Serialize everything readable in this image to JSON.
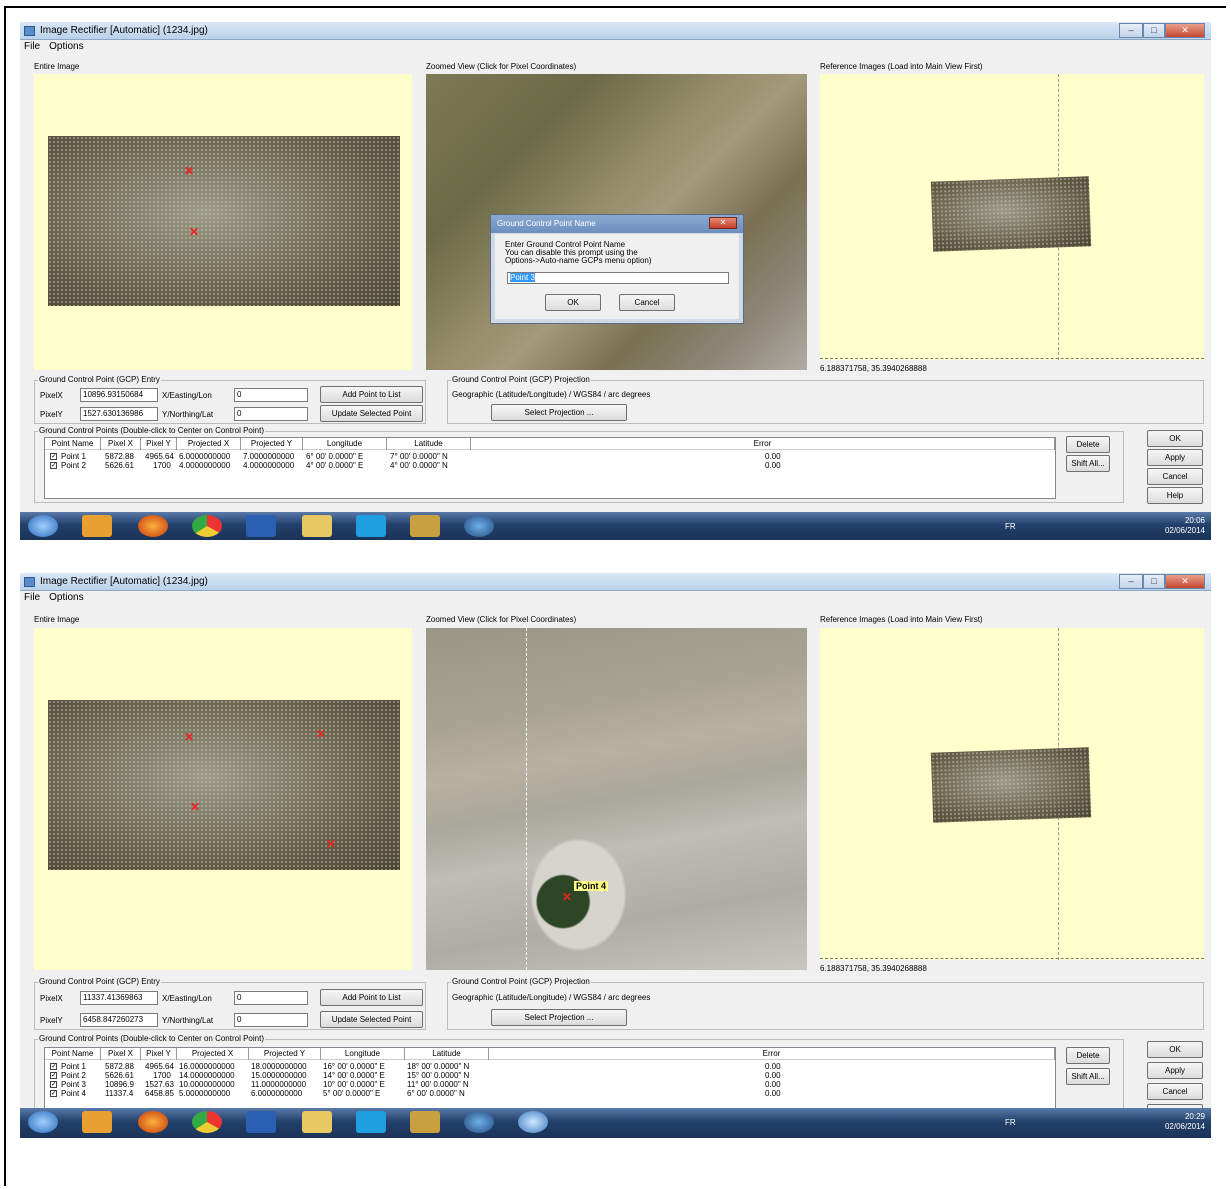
{
  "window": {
    "title": "Image Rectifier [Automatic] (1234.jpg)",
    "min": "–",
    "max": "□",
    "close": "✕"
  },
  "menu": {
    "file": "File",
    "options": "Options"
  },
  "labels": {
    "entire_image": "Entire Image",
    "zoomed_view": "Zoomed View (Click for Pixel Coordinates)",
    "reference_images": "Reference Images (Load into Main View First)",
    "gcp_entry": "Ground Control Point (GCP) Entry",
    "pixel_x": "PixelX",
    "pixel_y": "PixelY",
    "easting": "X/Easting/Lon",
    "northing": "Y/Northing/Lat",
    "gcp_projection": "Ground Control Point (GCP) Projection",
    "projection_value": "Geographic (Latitude/Longitude) / WGS84 / arc degrees",
    "gcp_list": "Ground Control Points (Double-click to Center on Control Point)"
  },
  "buttons": {
    "add_point": "Add Point to List",
    "update_point": "Update Selected Point",
    "select_projection": "Select Projection ...",
    "delete": "Delete",
    "shift_all": "Shift All...",
    "ok": "OK",
    "apply": "Apply",
    "cancel": "Cancel",
    "help": "Help"
  },
  "columns": [
    "Point Name",
    "Pixel X",
    "Pixel Y",
    "Projected X",
    "Projected Y",
    "Longitude",
    "Latitude",
    "Error"
  ],
  "shot1": {
    "pixel_x": "10896.93150684",
    "pixel_y": "1527.630136986",
    "easting": "0",
    "northing": "0",
    "ref_coord": "6.188371758, 35.3940268888",
    "rows": [
      {
        "name": "Point 1",
        "px": "5872.88",
        "py": "4965.64",
        "projx": "6.0000000000",
        "projy": "7.0000000000",
        "lon": "6° 00' 0.0000\" E",
        "lat": "7° 00' 0.0000\" N",
        "err": "0.00"
      },
      {
        "name": "Point 2",
        "px": "5626.61",
        "py": "1700",
        "projx": "4.0000000000",
        "projy": "4.0000000000",
        "lon": "4° 00' 0.0000\" E",
        "lat": "4° 00' 0.0000\" N",
        "err": "0.00"
      }
    ],
    "dialog": {
      "title": "Ground Control Point Name",
      "line1": "Enter Ground Control Point Name",
      "line2": "You can disable this prompt using the",
      "line3": "Options->Auto-name GCPs menu option)",
      "value": "Point 3",
      "ok": "OK",
      "cancel": "Cancel",
      "close": "✕"
    },
    "tray_lang": "FR",
    "time": "20:06",
    "date": "02/06/2014"
  },
  "shot2": {
    "pixel_x": "11337.41369863",
    "pixel_y": "6458.847260273",
    "easting": "0",
    "northing": "0",
    "ref_coord": "6.188371758, 35.3940268888",
    "point_callout": "Point 4",
    "rows": [
      {
        "name": "Point 1",
        "px": "5872.88",
        "py": "4965.64",
        "projx": "16.0000000000",
        "projy": "18.0000000000",
        "lon": "16° 00' 0.0000\" E",
        "lat": "18° 00' 0.0000\" N",
        "err": "0.00"
      },
      {
        "name": "Point 2",
        "px": "5626.61",
        "py": "1700",
        "projx": "14.0000000000",
        "projy": "15.0000000000",
        "lon": "14° 00' 0.0000\" E",
        "lat": "15° 00' 0.0000\" N",
        "err": "0.00"
      },
      {
        "name": "Point 3",
        "px": "10896.9",
        "py": "1527.63",
        "projx": "10.0000000000",
        "projy": "11.0000000000",
        "lon": "10° 00' 0.0000\" E",
        "lat": "11° 00' 0.0000\" N",
        "err": "0.00"
      },
      {
        "name": "Point 4",
        "px": "11337.4",
        "py": "6458.85",
        "projx": "5.0000000000",
        "projy": "6.0000000000",
        "lon": "5° 00' 0.0000\" E",
        "lat": "6° 00' 0.0000\" N",
        "err": "0.00"
      }
    ],
    "tray_lang": "FR",
    "time": "20:29",
    "date": "02/06/2014"
  },
  "taskbar_icons": [
    "start-orb-icon",
    "media-player-icon",
    "firefox-icon",
    "chrome-icon",
    "word-icon",
    "explorer-icon",
    "skype-icon",
    "app-icon",
    "globe-icon",
    "browser-icon"
  ],
  "colors": {
    "pane_bg": "#ffffcc",
    "marker": "#ee2222",
    "taskbar": "#23406b"
  }
}
